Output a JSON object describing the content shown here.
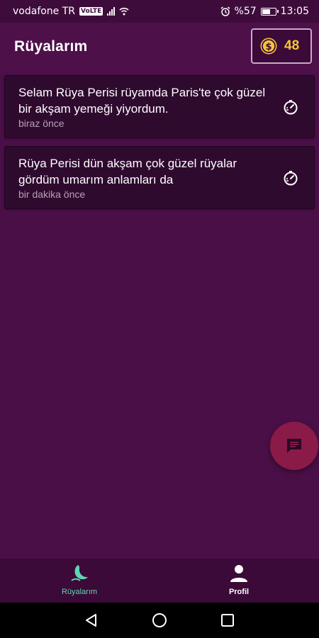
{
  "status_bar": {
    "carrier": "vodafone TR",
    "volte": "VoLTE",
    "battery_text": "%57",
    "battery_level": 0.57,
    "time": "13:05"
  },
  "header": {
    "title": "Rüyalarım",
    "coin_count": "48"
  },
  "dreams": [
    {
      "text": "Selam Rüya Perisi rüyamda Paris'te çok güzel bir akşam yemeği yiyordum.",
      "time": "biraz önce"
    },
    {
      "text": "Rüya Perisi dün akşam çok güzel rüyalar gördüm umarım anlamları da",
      "time": "bir dakika önce"
    }
  ],
  "bottom_nav": {
    "dreams_label": "Rüyalarım",
    "profile_label": "Profil"
  },
  "colors": {
    "background": "#4b0f47",
    "card": "#2f0a2f",
    "accent": "#5fd6b0",
    "coin": "#f5c53a",
    "fab": "#8a1a48"
  },
  "icons": {
    "coin": "dollar-coin-icon",
    "card": "timer-icon",
    "fab": "chat-icon",
    "nav_dreams": "moon-icon",
    "nav_profile": "person-icon"
  }
}
